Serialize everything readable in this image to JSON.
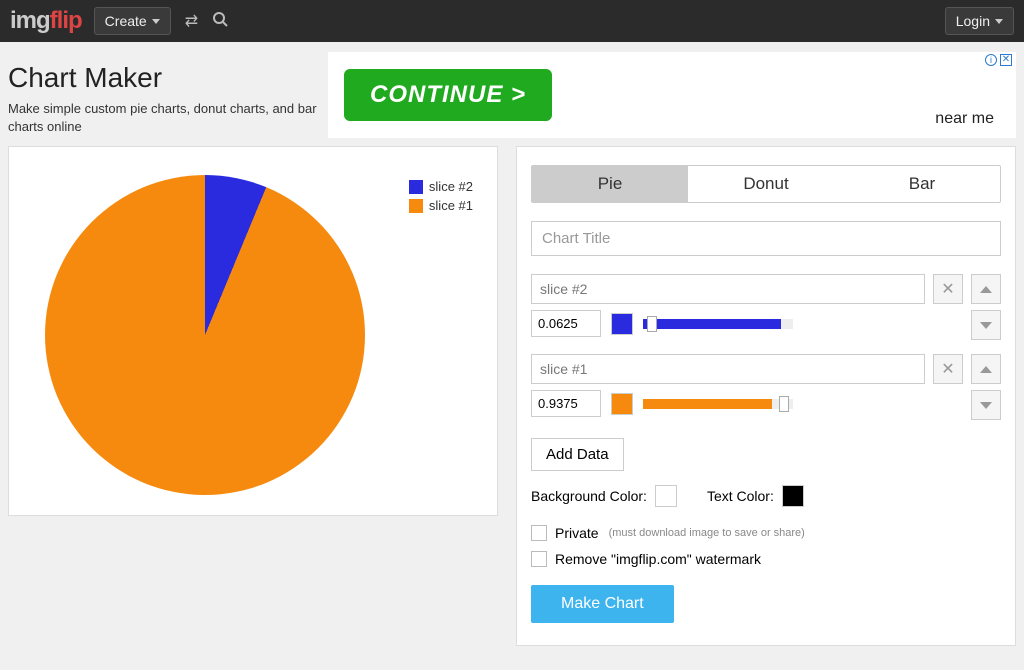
{
  "header": {
    "logo_a": "img",
    "logo_b": "flip",
    "create": "Create",
    "login": "Login"
  },
  "page": {
    "title": "Chart Maker",
    "subtitle": "Make simple custom pie charts, donut charts, and bar charts online"
  },
  "ad": {
    "cta": "CONTINUE >",
    "tag": "near me",
    "info": "i"
  },
  "tabs": {
    "pie": "Pie",
    "donut": "Donut",
    "bar": "Bar",
    "active": "pie"
  },
  "title_input": {
    "placeholder": "Chart Title",
    "value": ""
  },
  "slices": [
    {
      "name": "slice #2",
      "value": "0.0625",
      "color": "#2a2adf",
      "slider_pct": 92,
      "thumb_pct": 6
    },
    {
      "name": "slice #1",
      "value": "0.9375",
      "color": "#f58a0e",
      "slider_pct": 86,
      "thumb_pct": 94
    }
  ],
  "buttons": {
    "add_data": "Add Data",
    "make_chart": "Make Chart"
  },
  "labels": {
    "bg_color": "Background Color:",
    "text_color": "Text Color:",
    "private": "Private",
    "private_hint": "(must download image to save or share)",
    "remove_wm": "Remove \"imgflip.com\" watermark"
  },
  "colors": {
    "bg": "#ffffff",
    "text": "#000000"
  },
  "legend": [
    {
      "label": "slice #2",
      "color": "#2a2adf"
    },
    {
      "label": "slice #1",
      "color": "#f58a0e"
    }
  ],
  "chart_data": {
    "type": "pie",
    "title": "",
    "series": [
      {
        "name": "slice #2",
        "value": 0.0625,
        "color": "#2a2adf"
      },
      {
        "name": "slice #1",
        "value": 0.9375,
        "color": "#f58a0e"
      }
    ]
  }
}
